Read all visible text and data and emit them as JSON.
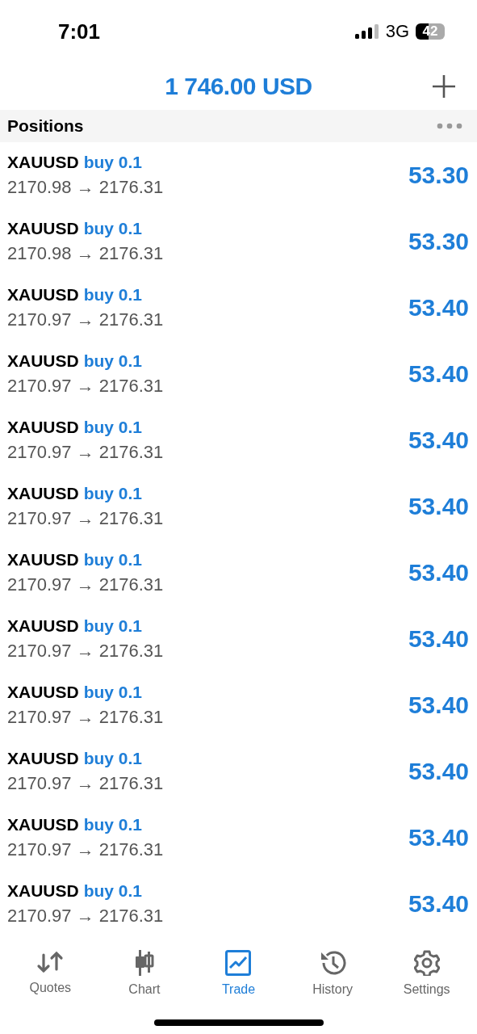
{
  "status_bar": {
    "time": "7:01",
    "network": "3G",
    "battery": "42"
  },
  "header": {
    "balance": "1 746.00 USD"
  },
  "section": {
    "title": "Positions"
  },
  "positions": [
    {
      "symbol": "XAUUSD",
      "side": "buy 0.1",
      "prices": "2170.98 → 2176.31",
      "profit": "53.30"
    },
    {
      "symbol": "XAUUSD",
      "side": "buy 0.1",
      "prices": "2170.98 → 2176.31",
      "profit": "53.30"
    },
    {
      "symbol": "XAUUSD",
      "side": "buy 0.1",
      "prices": "2170.97 → 2176.31",
      "profit": "53.40"
    },
    {
      "symbol": "XAUUSD",
      "side": "buy 0.1",
      "prices": "2170.97 → 2176.31",
      "profit": "53.40"
    },
    {
      "symbol": "XAUUSD",
      "side": "buy 0.1",
      "prices": "2170.97 → 2176.31",
      "profit": "53.40"
    },
    {
      "symbol": "XAUUSD",
      "side": "buy 0.1",
      "prices": "2170.97 → 2176.31",
      "profit": "53.40"
    },
    {
      "symbol": "XAUUSD",
      "side": "buy 0.1",
      "prices": "2170.97 → 2176.31",
      "profit": "53.40"
    },
    {
      "symbol": "XAUUSD",
      "side": "buy 0.1",
      "prices": "2170.97 → 2176.31",
      "profit": "53.40"
    },
    {
      "symbol": "XAUUSD",
      "side": "buy 0.1",
      "prices": "2170.97 → 2176.31",
      "profit": "53.40"
    },
    {
      "symbol": "XAUUSD",
      "side": "buy 0.1",
      "prices": "2170.97 → 2176.31",
      "profit": "53.40"
    },
    {
      "symbol": "XAUUSD",
      "side": "buy 0.1",
      "prices": "2170.97 → 2176.31",
      "profit": "53.40"
    },
    {
      "symbol": "XAUUSD",
      "side": "buy 0.1",
      "prices": "2170.97 → 2176.31",
      "profit": "53.40"
    }
  ],
  "tabs": [
    {
      "kind": "quotes",
      "label": "Quotes",
      "selected": false
    },
    {
      "kind": "chart",
      "label": "Chart",
      "selected": false
    },
    {
      "kind": "trade",
      "label": "Trade",
      "selected": true
    },
    {
      "kind": "history",
      "label": "History",
      "selected": false
    },
    {
      "kind": "settings",
      "label": "Settings",
      "selected": false
    }
  ]
}
